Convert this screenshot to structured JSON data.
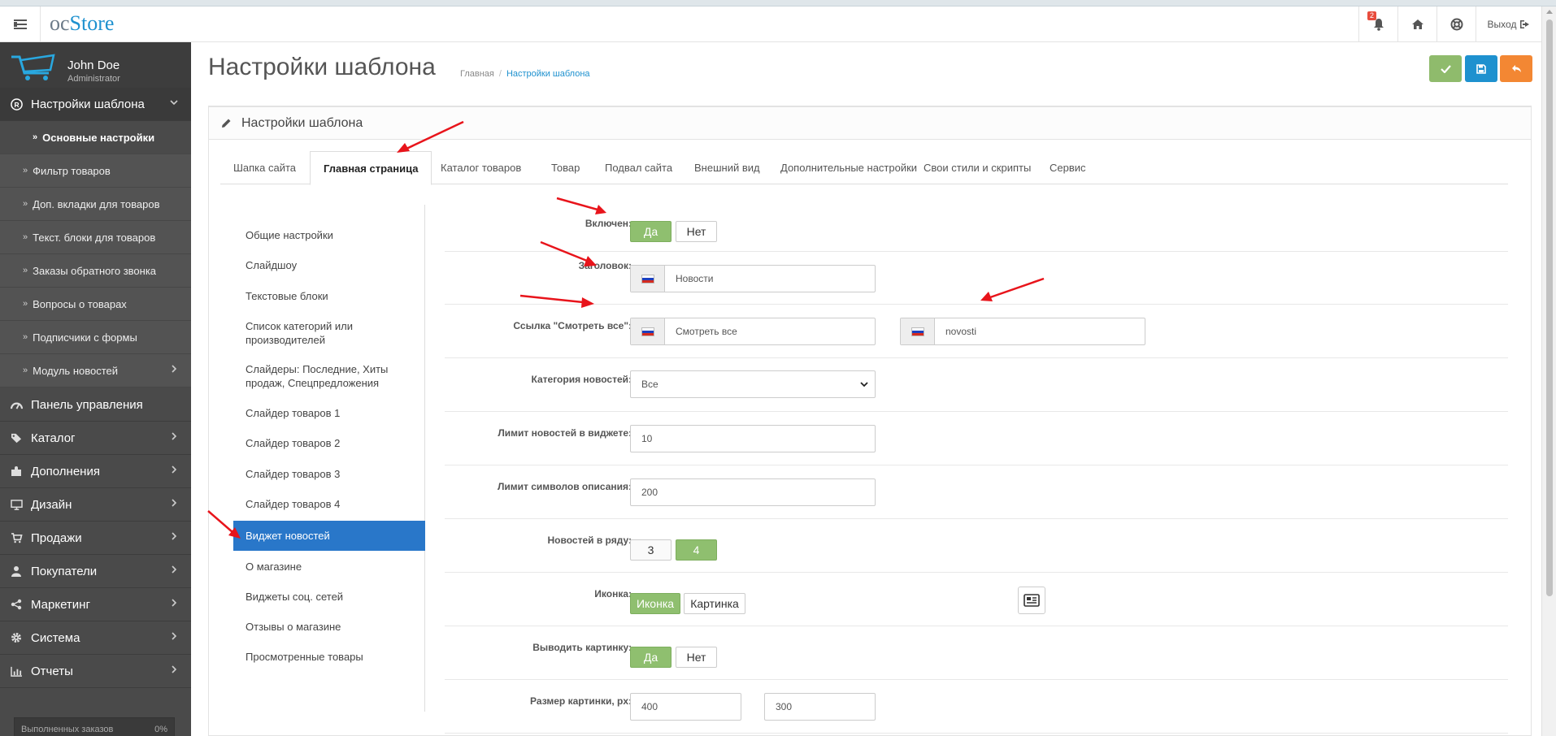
{
  "header": {
    "logo_prefix": "oc",
    "logo_suffix": "Store",
    "notifications_count": "2",
    "logout_label": "Выход"
  },
  "profile": {
    "name": "John Doe",
    "role": "Administrator"
  },
  "sidebar": {
    "template_settings": "Настройки шаблона",
    "sub_items": [
      "Основные настройки",
      "Фильтр товаров",
      "Доп. вкладки для товаров",
      "Текст. блоки для товаров",
      "Заказы обратного звонка",
      "Вопросы о товарах",
      "Подписчики с формы",
      "Модуль новостей"
    ],
    "main_items": [
      "Панель управления",
      "Каталог",
      "Дополнения",
      "Дизайн",
      "Продажи",
      "Покупатели",
      "Маркетинг",
      "Система",
      "Отчеты"
    ],
    "progress_label": "Выполненных заказов",
    "progress_value": "0%"
  },
  "page": {
    "title": "Настройки шаблона",
    "breadcrumb_home": "Главная",
    "breadcrumb_current": "Настройки шаблона",
    "panel_title": "Настройки шаблона"
  },
  "tabs": [
    "Шапка сайта",
    "Главная страница",
    "Каталог товаров",
    "Товар",
    "Подвал сайта",
    "Внешний вид",
    "Дополнительные настройки",
    "Свои стили и скрипты",
    "Сервис"
  ],
  "left_nav": [
    "Общие настройки",
    "Слайдшоу",
    "Текстовые блоки",
    "Список категорий или производителей",
    "Слайдеры: Последние, Хиты продаж, Спецпредложения",
    "Слайдер товаров 1",
    "Слайдер товаров 2",
    "Слайдер товаров 3",
    "Слайдер товаров 4",
    "Виджет новостей",
    "О магазине",
    "Виджеты соц. сетей",
    "Отзывы о магазине",
    "Просмотренные товары"
  ],
  "form": {
    "enabled": {
      "label": "Включен:",
      "yes": "Да",
      "no": "Нет"
    },
    "heading": {
      "label": "Заголовок:",
      "value": "Новости"
    },
    "view_all": {
      "label": "Ссылка \"Смотреть все\":",
      "text_value": "Смотреть все",
      "url_value": "novosti"
    },
    "category": {
      "label": "Категория новостей:",
      "value": "Все"
    },
    "limit": {
      "label": "Лимит новостей в виджете:",
      "value": "10"
    },
    "desc_limit": {
      "label": "Лимит символов описания:",
      "value": "200"
    },
    "per_row": {
      "label": "Новостей в ряду:",
      "opt1": "3",
      "opt2": "4"
    },
    "icon": {
      "label": "Иконка:",
      "opt1": "Иконка",
      "opt2": "Картинка"
    },
    "show_image": {
      "label": "Выводить картинку:",
      "yes": "Да",
      "no": "Нет"
    },
    "image_size": {
      "label": "Размер картинки, px:",
      "width": "400",
      "height": "300"
    }
  },
  "colors": {
    "sidebar": "#4a4a4a",
    "accent_blue": "#2977c9",
    "toggle_green": "#8fbf6f",
    "btn_orange": "#f38733",
    "btn_blue": "#1e91cf",
    "btn_green": "#8fbb6c",
    "annotation_red": "#e8141b"
  }
}
